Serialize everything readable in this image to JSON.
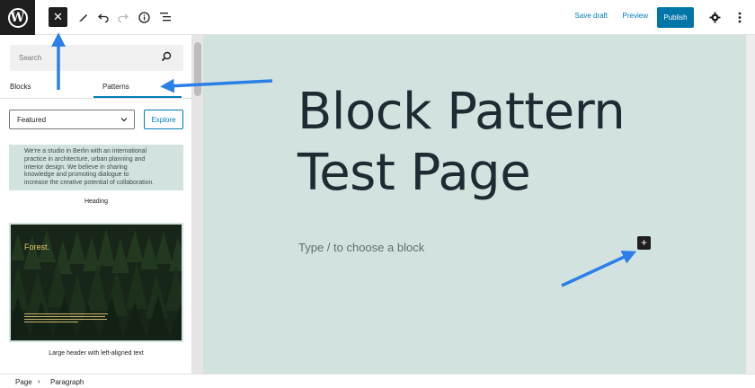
{
  "topbar": {
    "close_icon": "close-icon",
    "save_draft": "Save draft",
    "preview": "Preview",
    "publish": "Publish"
  },
  "sidebar": {
    "search_placeholder": "Search",
    "tabs": [
      {
        "label": "Blocks",
        "selected": false
      },
      {
        "label": "Patterns",
        "selected": true
      }
    ],
    "category": "Featured",
    "explore": "Explore",
    "patterns": [
      {
        "preview_text": [
          "We’re a studio in Berlin with an international",
          "practice in architecture, urban planning and",
          "interior design. We believe in sharing",
          "knowledge and promoting dialogue to",
          "increase the creative potential of collaboration."
        ],
        "caption": "Heading"
      },
      {
        "preview_title": "Forest.",
        "caption": "Large header with left-aligned text"
      }
    ]
  },
  "editor": {
    "title_lines": [
      "Block Pattern",
      "Test Page"
    ],
    "placeholder": "Type / to choose a block",
    "inserter_icon": "plus-icon"
  },
  "breadcrumb": {
    "items": [
      "Page",
      "Paragraph"
    ]
  },
  "colors": {
    "accent": "#007cba",
    "publish_bg": "#0075a8",
    "canvas_bg": "#d2e3df",
    "arrow": "#2b7fe8"
  }
}
